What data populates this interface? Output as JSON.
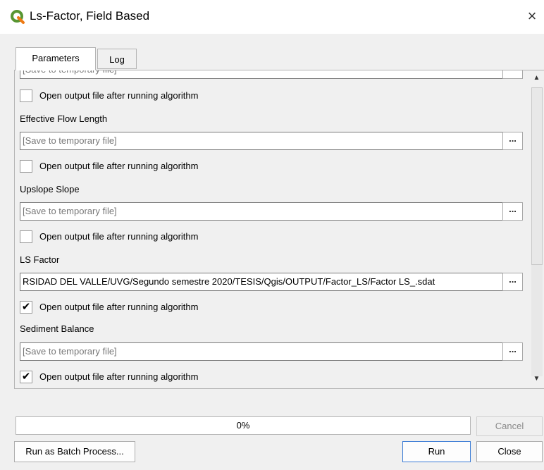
{
  "window": {
    "title": "Ls-Factor, Field Based",
    "close_glyph": "×",
    "icon": "qgis-logo-icon"
  },
  "tabs": [
    {
      "label": "Parameters",
      "active": true
    },
    {
      "label": "Log",
      "active": false
    }
  ],
  "params": {
    "top_partial_field": "[Save to temporary file]",
    "top_open_output": {
      "label": "Open output file after running algorithm",
      "checked": false
    },
    "effective_flow_length": {
      "label": "Effective Flow Length",
      "value": "[Save to temporary file]",
      "open_output": {
        "label": "Open output file after running algorithm",
        "checked": false
      }
    },
    "upslope_slope": {
      "label": "Upslope Slope",
      "value": "[Save to temporary file]",
      "open_output": {
        "label": "Open output file after running algorithm",
        "checked": false
      }
    },
    "ls_factor": {
      "label": "LS Factor",
      "value": "RSIDAD DEL VALLE/UVG/Segundo semestre 2020/TESIS/Qgis/OUTPUT/Factor_LS/Factor LS_.sdat",
      "open_output": {
        "label": "Open output file after running algorithm",
        "checked": true
      }
    },
    "sediment_balance": {
      "label": "Sediment Balance",
      "value": "[Save to temporary file]",
      "open_output": {
        "label": "Open output file after running algorithm",
        "checked": true
      }
    },
    "browse_label": "...",
    "check_glyph": "✔"
  },
  "scrollbar": {
    "up": "▲",
    "down": "▼"
  },
  "progress": {
    "value": 0,
    "text": "0%",
    "color": "#3daee9"
  },
  "buttons": {
    "cancel": "Cancel",
    "batch": "Run as Batch Process...",
    "run": "Run",
    "close": "Close"
  }
}
